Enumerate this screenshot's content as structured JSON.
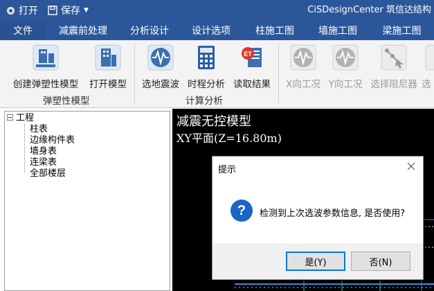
{
  "titlebar": {
    "open_label": "打开",
    "save_label": "保存",
    "app_title": "CiSDesignCenter 筑信达结构"
  },
  "menu": [
    "文件",
    "减震前处理",
    "分析设计",
    "设计选项",
    "柱施工图",
    "墙施工图",
    "梁施工图"
  ],
  "ribbon": {
    "buttons": [
      {
        "label": "创建弹塑性模型",
        "icon": "create-model-icon",
        "enabled": true
      },
      {
        "label": "打开模型",
        "icon": "open-model-icon",
        "enabled": true
      },
      {
        "label": "选地震波",
        "icon": "seismic-wave-icon",
        "enabled": true
      },
      {
        "label": "时程分析",
        "icon": "calculator-icon",
        "enabled": true
      },
      {
        "label": "读取结果",
        "icon": "read-results-icon",
        "enabled": true
      },
      {
        "label": "X向工况",
        "icon": "x-case-icon",
        "enabled": false
      },
      {
        "label": "Y向工况",
        "icon": "y-case-icon",
        "enabled": false
      },
      {
        "label": "选择阻尼器",
        "icon": "select-damper-icon",
        "enabled": false
      },
      {
        "label": "选",
        "icon": "cut-off-icon",
        "enabled": false
      }
    ],
    "groups": [
      "弹塑性模型",
      "计算分析"
    ]
  },
  "tree": {
    "root": "工程",
    "children": [
      "柱表",
      "边缘构件表",
      "墙身表",
      "连梁表",
      "全部楼层"
    ]
  },
  "viewport": {
    "line1": "减震无控模型",
    "line2": "XY平面(Z=16.80m)"
  },
  "dialog": {
    "title": "提示",
    "message": "检测到上次选波参数信息, 是否使用?",
    "yes_label": "是(Y)",
    "no_label": "否(N)"
  },
  "colors": {
    "accent": "#2b579a",
    "viewport_bg": "#000000",
    "question_icon": "#1e63c7"
  }
}
